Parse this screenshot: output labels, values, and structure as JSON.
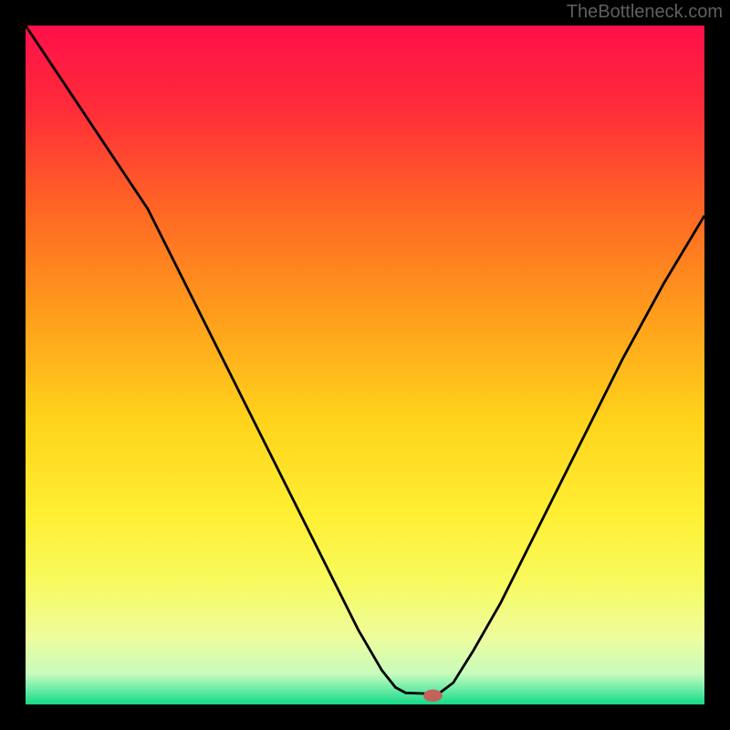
{
  "attribution": "TheBottleneck.com",
  "chart_data": {
    "type": "line",
    "title": "",
    "xlabel": "",
    "ylabel": "",
    "xlim": [
      0,
      100
    ],
    "ylim": [
      0,
      100
    ],
    "curve": [
      {
        "x": 0,
        "y": 100
      },
      {
        "x": 6,
        "y": 91
      },
      {
        "x": 12,
        "y": 82
      },
      {
        "x": 18,
        "y": 73
      },
      {
        "x": 21,
        "y": 67
      },
      {
        "x": 26,
        "y": 57
      },
      {
        "x": 32,
        "y": 45
      },
      {
        "x": 38,
        "y": 33
      },
      {
        "x": 44,
        "y": 21
      },
      {
        "x": 49,
        "y": 11
      },
      {
        "x": 52.5,
        "y": 5
      },
      {
        "x": 54.5,
        "y": 2.5
      },
      {
        "x": 56,
        "y": 1.7
      },
      {
        "x": 59,
        "y": 1.6
      },
      {
        "x": 61,
        "y": 1.7
      },
      {
        "x": 63,
        "y": 3.2
      },
      {
        "x": 66,
        "y": 8
      },
      {
        "x": 70,
        "y": 15
      },
      {
        "x": 76,
        "y": 27
      },
      {
        "x": 82,
        "y": 39
      },
      {
        "x": 88,
        "y": 51
      },
      {
        "x": 94,
        "y": 62
      },
      {
        "x": 100,
        "y": 72
      }
    ],
    "marker": {
      "x": 60,
      "y": 1.3
    },
    "gradient_stops": [
      {
        "offset": 0.0,
        "color": "#ff1049"
      },
      {
        "offset": 0.12,
        "color": "#ff2b3a"
      },
      {
        "offset": 0.28,
        "color": "#ff6a23"
      },
      {
        "offset": 0.42,
        "color": "#ff9b1c"
      },
      {
        "offset": 0.58,
        "color": "#ffd31b"
      },
      {
        "offset": 0.72,
        "color": "#ffef33"
      },
      {
        "offset": 0.82,
        "color": "#f8fa5f"
      },
      {
        "offset": 0.9,
        "color": "#eefd9c"
      },
      {
        "offset": 0.955,
        "color": "#c7fcbc"
      },
      {
        "offset": 0.98,
        "color": "#63eaa4"
      },
      {
        "offset": 1.0,
        "color": "#14d886"
      }
    ],
    "marker_color": "#c1625b",
    "curve_color": "#000000"
  }
}
